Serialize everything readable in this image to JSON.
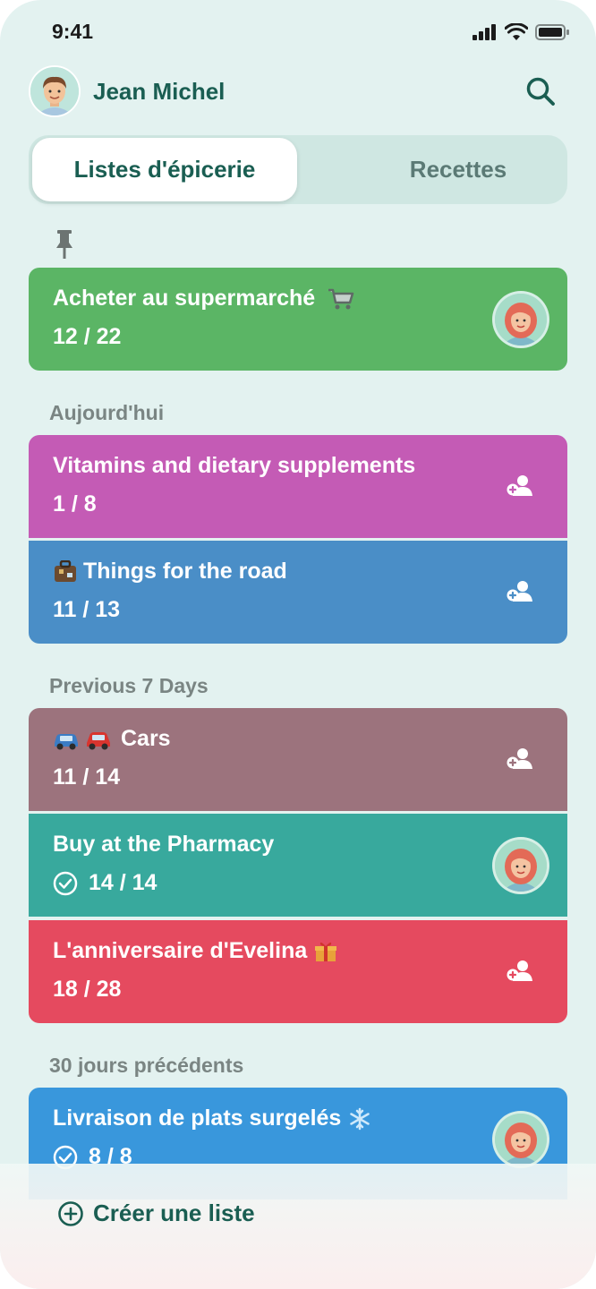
{
  "status_bar": {
    "time": "9:41"
  },
  "header": {
    "user_name": "Jean Michel"
  },
  "tabs": [
    {
      "label": "Listes d'épicerie",
      "active": true
    },
    {
      "label": "Recettes",
      "active": false
    }
  ],
  "pinned": {
    "icon": "pin-icon",
    "list": {
      "title": "Acheter au supermarché",
      "count": "12 / 22",
      "color": "#5bb565",
      "emoji": "cart"
    }
  },
  "sections": {
    "today": {
      "label": "Aujourd'hui",
      "lists": [
        {
          "title": "Vitamins and dietary supplements",
          "count": "1 / 8",
          "color": "#c45bb5"
        },
        {
          "title": "Things for the road",
          "count": "11 / 13",
          "color": "#4a8ec7",
          "emoji": "suitcase"
        }
      ]
    },
    "previous_7": {
      "label": "Previous 7 Days",
      "lists": [
        {
          "title": "Cars",
          "count": "11 / 14",
          "color": "#9c737d",
          "emoji": "cars"
        },
        {
          "title": "Buy at the Pharmacy",
          "count": "14 / 14",
          "color": "#38a99d",
          "completed": true
        },
        {
          "title": "L'anniversaire d'Evelina",
          "count": "18 / 28",
          "color": "#e54a5f",
          "emoji": "gift"
        }
      ]
    },
    "previous_30": {
      "label": "30 jours précédents",
      "lists": [
        {
          "title": "Livraison de plats surgelés",
          "count": "8 / 8",
          "color": "#3997dc",
          "emoji": "snowflake",
          "completed": true
        }
      ]
    }
  },
  "footer": {
    "create_label": "Créer une liste"
  }
}
